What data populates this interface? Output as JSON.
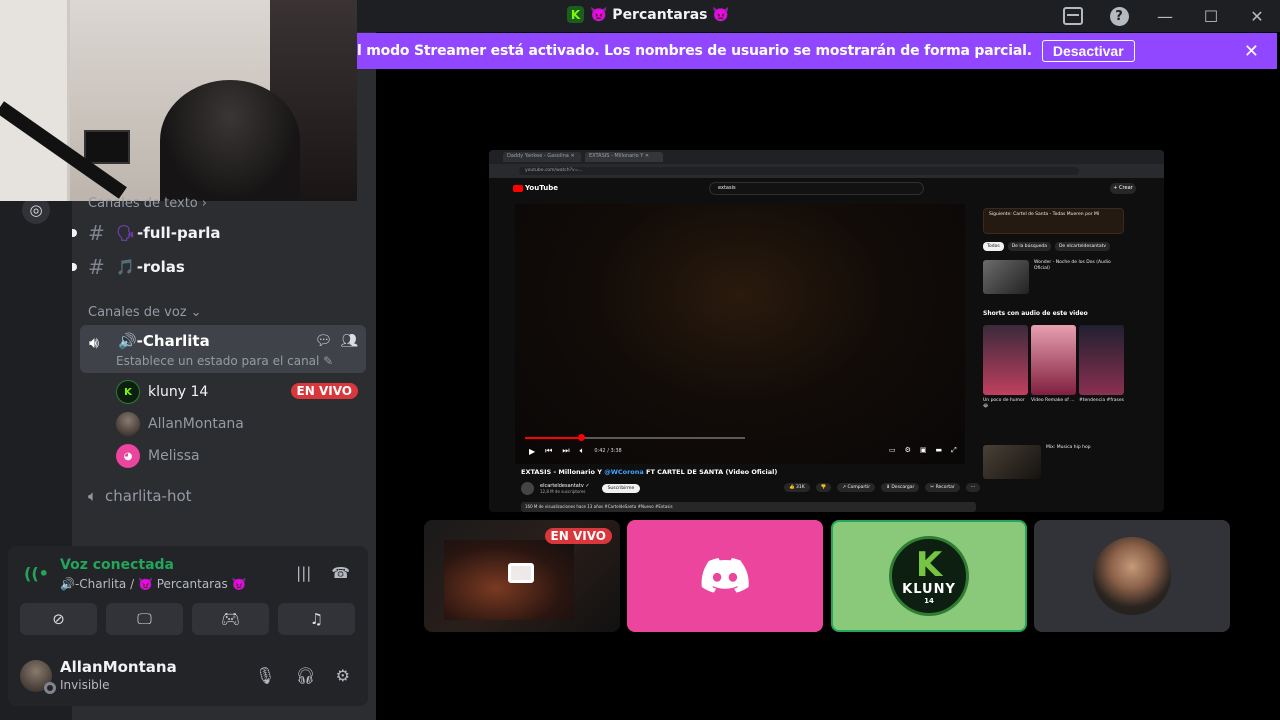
{
  "window": {
    "title": "👿 Percantaras 👿",
    "server_logo_letter": "K"
  },
  "banner": {
    "text": "l modo Streamer está activado. Los nombres de usuario se mostrarán de forma parcial.",
    "button": "Desactivar",
    "color": "#9147ff"
  },
  "sidebar": {
    "text_category": "Canales de texto",
    "text_channels": [
      {
        "name": "-full-parla",
        "emoji": "🗣"
      },
      {
        "name": "-rolas",
        "emoji": "🎵"
      }
    ],
    "voice_category": "Canales de voz",
    "voice_channel": {
      "name": "🔊-Charlita",
      "status": "Establece un estado para el canal ✎"
    },
    "members": [
      {
        "name": "kluny 14",
        "live": true
      },
      {
        "name": "AllanMontana",
        "live": false
      },
      {
        "name": "Melissa",
        "live": false
      }
    ],
    "live_label": "EN VIVO",
    "voice_channel_2": "charlita-hot"
  },
  "voice_panel": {
    "title": "Voz conectada",
    "subtitle": "🔊-Charlita / 👿 Percantaras 👿"
  },
  "user_panel": {
    "name": "AllanMontana",
    "status": "Invisible"
  },
  "stream": {
    "tabs": [
      "Daddy Yankee - Gasolina ✕",
      "EXTASIS - Millonario Y ✕"
    ],
    "url": "youtube.com/watch?v=...",
    "search": "extasis",
    "create_label": "+ Crear",
    "youtube_label": "YouTube",
    "time": "0:42 / 3:38",
    "video_title_main": "EXTASIS - Millonario Y",
    "video_title_link": "@WCorona",
    "video_title_rest": " FT CARTEL DE SANTA (Video Oficial)",
    "channel_name": "elcarteldesantatv ✓",
    "channel_subs": "12,8 M de suscriptores",
    "subscribe": "Suscribirme",
    "actions": [
      "👍 31K",
      "👎",
      "↗ Compartir",
      "⬇ Descargar",
      "✂ Recortar",
      "⋯"
    ],
    "desc": "160 M de visualizaciones  hace 13 años  #CarteldeSanta #Nuevo #Extasis",
    "up_next": "Siguiente: Cartel de Santa - Todas Mueren por Mí",
    "chips": [
      "Todos",
      "De la búsqueda",
      "De elcarteldesantatv"
    ],
    "rec1_title": "Wonder - Noche de los Dos (Audio Oficial)",
    "shorts_title": "Shorts con audio de este video",
    "shorts": [
      "Un poco de humor 😂",
      "Video Remake of ...",
      "#tendencia #frases"
    ],
    "rec2_title": "Mix: Musica hip hop"
  },
  "tiles": {
    "live_label": "EN VIVO",
    "kluny_name": "KLUNY",
    "kluny_num": "14"
  }
}
